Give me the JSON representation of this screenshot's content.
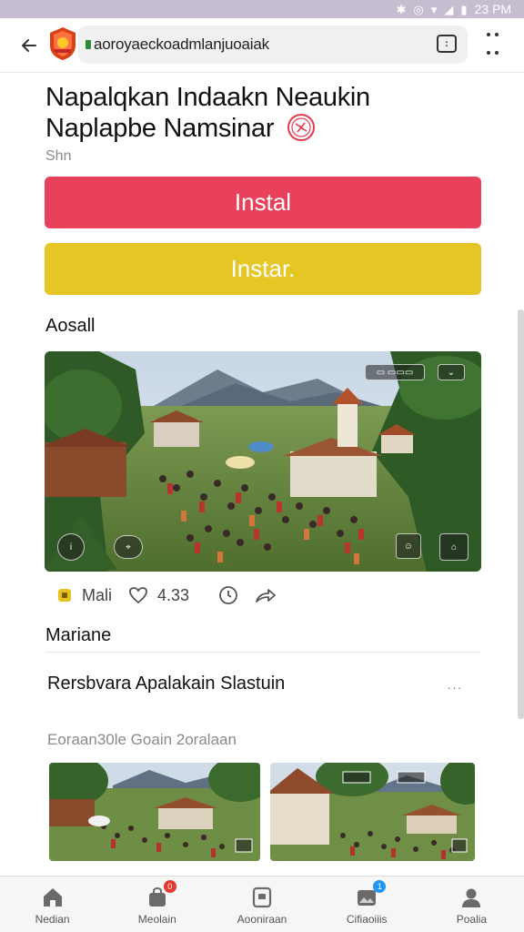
{
  "status_bar": {
    "time": "23 PM"
  },
  "url_bar": {
    "url": "aoroyaeckoadmlanjuoaiak"
  },
  "page": {
    "title": "Napalqkan Indaakn Neaukin Naplapbe Namsinar",
    "subtitle": "Shn",
    "install_primary": "Instal",
    "install_secondary": "Instar.",
    "section_1": "Aosall",
    "section_2": "Mariane"
  },
  "hero_actions": {
    "label_1": "Mali",
    "count": "4.33"
  },
  "article": {
    "title": "Rersbvara Apalakain Slastuin",
    "meta": "Eoraan30le Goain 2oralaan",
    "more": "..."
  },
  "bottom_nav": {
    "items": [
      {
        "label": "Nedian",
        "icon": "home-icon",
        "badge": ""
      },
      {
        "label": "Meolain",
        "icon": "bag-icon",
        "badge": "0"
      },
      {
        "label": "Aooniraan",
        "icon": "card-icon",
        "badge": ""
      },
      {
        "label": "Cifiaoiiis",
        "icon": "gallery-icon",
        "badge": "1"
      },
      {
        "label": "Poalia",
        "icon": "profile-icon",
        "badge": ""
      }
    ]
  },
  "colors": {
    "status_bar": "#c7bdd0",
    "install_primary": "#e9415c",
    "install_secondary": "#e6c624",
    "nav_badge_red": "#e53935",
    "nav_badge_blue": "#2196f3"
  }
}
